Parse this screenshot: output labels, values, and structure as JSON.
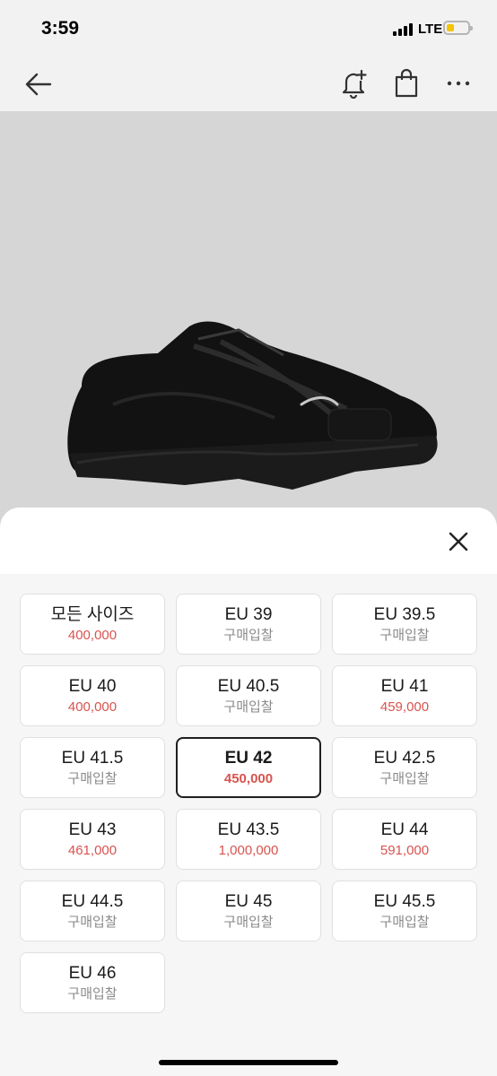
{
  "status_bar": {
    "time": "3:59",
    "network": "LTE",
    "battery_color": "#f5c400"
  },
  "nav": {
    "icons": [
      "back-arrow-icon",
      "bell-plus-icon",
      "shopping-bag-icon",
      "more-dots-icon"
    ]
  },
  "product": {
    "image": "black-sneaker",
    "background": "#d6d6d6"
  },
  "sheet": {
    "close_icon": "close-icon",
    "sizes": [
      {
        "size": "모든 사이즈",
        "price": "400,000",
        "has_price": true
      },
      {
        "size": "EU 39",
        "price": "구매입찰",
        "has_price": false
      },
      {
        "size": "EU 39.5",
        "price": "구매입찰",
        "has_price": false
      },
      {
        "size": "EU 40",
        "price": "400,000",
        "has_price": true
      },
      {
        "size": "EU 40.5",
        "price": "구매입찰",
        "has_price": false
      },
      {
        "size": "EU 41",
        "price": "459,000",
        "has_price": true
      },
      {
        "size": "EU 41.5",
        "price": "구매입찰",
        "has_price": false
      },
      {
        "size": "EU 42",
        "price": "450,000",
        "has_price": true,
        "selected": true
      },
      {
        "size": "EU 42.5",
        "price": "구매입찰",
        "has_price": false
      },
      {
        "size": "EU 43",
        "price": "461,000",
        "has_price": true
      },
      {
        "size": "EU 43.5",
        "price": "1,000,000",
        "has_price": true
      },
      {
        "size": "EU 44",
        "price": "591,000",
        "has_price": true
      },
      {
        "size": "EU 44.5",
        "price": "구매입찰",
        "has_price": false
      },
      {
        "size": "EU 45",
        "price": "구매입찰",
        "has_price": false
      },
      {
        "size": "EU 45.5",
        "price": "구매입찰",
        "has_price": false
      },
      {
        "size": "EU 46",
        "price": "구매입찰",
        "has_price": false
      }
    ]
  },
  "colors": {
    "price_red": "#d9534f",
    "muted_gray": "#8a8a8a",
    "selected_border": "#1f1f1f"
  }
}
